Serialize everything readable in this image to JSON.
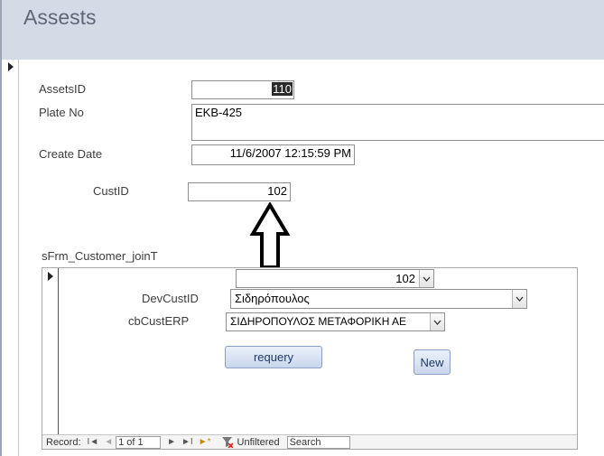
{
  "form": {
    "title": "Assests"
  },
  "fields": {
    "assets_id": {
      "label": "AssetsID",
      "value": "110"
    },
    "plate_no": {
      "label": "Plate No",
      "value": "EKB-425"
    },
    "create_date": {
      "label": "Create Date",
      "value": "11/6/2007 12:15:59 PM"
    },
    "cust_id": {
      "label": "CustID",
      "value": "102"
    }
  },
  "subform": {
    "label": "sFrm_Customer_joinT",
    "top_combo_value": "102",
    "dev_cust_id": {
      "label": "DevCustID",
      "value": "Σιδηρόπουλος"
    },
    "cb_cust_erp": {
      "label": "cbCustERP",
      "value": "ΣΙΔΗΡΟΠΟΥΛΟΣ ΜΕΤΑΦΟΡΙΚΗ ΑΕ"
    },
    "requery_label": "requery",
    "new_label": "New",
    "nav": {
      "record_label": "Record:",
      "first": "I◄",
      "prev": "◄",
      "position": "1 of 1",
      "next": "►",
      "last": "►I",
      "new_record": "►*",
      "filter_label": "Unfiltered",
      "search_label": "Search"
    }
  },
  "icons": {
    "record_selector": "record-pointer-icon",
    "annotation": "up-arrow-icon",
    "filter": "no-filter-icon",
    "dropdown": "chevron-down-icon"
  }
}
